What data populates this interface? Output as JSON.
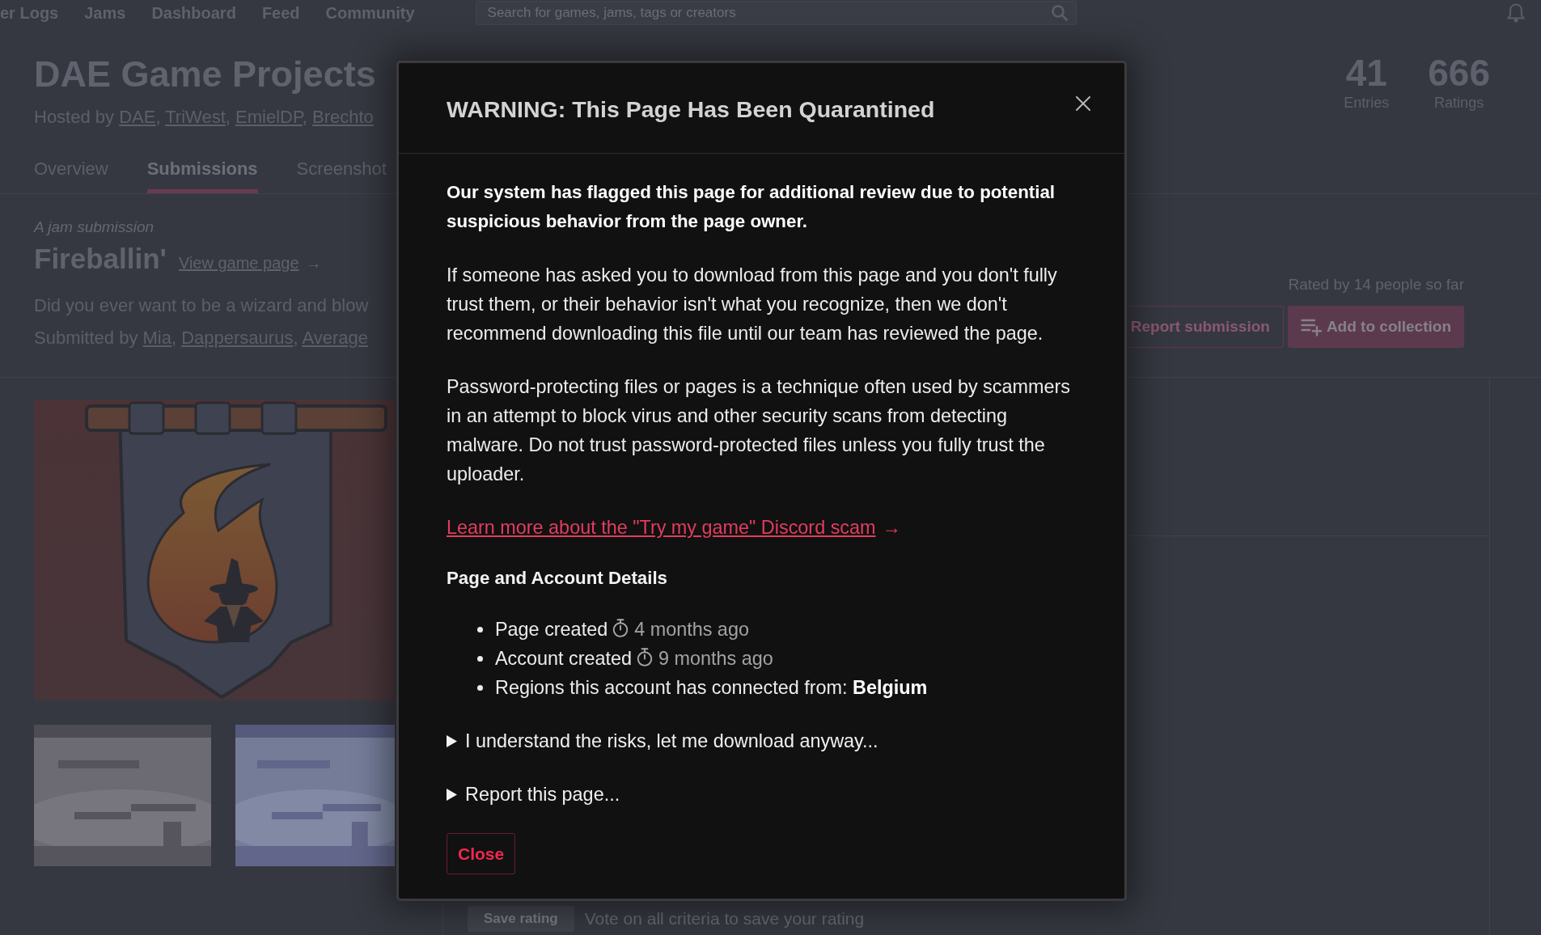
{
  "top_nav": {
    "links": [
      "er Logs",
      "Jams",
      "Dashboard",
      "Feed",
      "Community"
    ],
    "search": {
      "placeholder": "Search for games, jams, tags or creators"
    }
  },
  "jam": {
    "title": "DAE Game Projects",
    "hosted_by": {
      "label": "Hosted by",
      "separator": ", ",
      "hosts": [
        "DAE",
        "TriWest",
        "EmielDP",
        "Brechto"
      ]
    },
    "stats": [
      {
        "value": "41",
        "label": "Entries"
      },
      {
        "value": "666",
        "label": "Ratings"
      }
    ]
  },
  "tabs": [
    {
      "label": "Overview",
      "selected": false
    },
    {
      "label": "Submissions",
      "selected": true
    },
    {
      "label": "Screenshot",
      "selected": false
    }
  ],
  "submission": {
    "eyebrow": "A jam submission",
    "title": "Fireballin'",
    "game_link": {
      "text": "View game page",
      "arrow": "→"
    },
    "description": "Did you ever want to be a wizard and blow",
    "submitted_by": {
      "label": "Submitted by",
      "separator": ", ",
      "authors": [
        "Mia",
        "Dappersaurus",
        "Average"
      ]
    },
    "rated_by": "Rated by 14 people so far",
    "buttons": [
      {
        "kind": "outlined",
        "label": "Report submission"
      },
      {
        "kind": "primary",
        "label": "Add to collection"
      }
    ]
  },
  "media": {
    "screenshots": [
      {
        "kind": "cave"
      },
      {
        "kind": "sky"
      }
    ]
  },
  "rating": {
    "save_button": {
      "label": "Save rating",
      "disabled": true
    },
    "hint": "Vote on all criteria to save your rating"
  },
  "modal": {
    "title": "WARNING: This Page Has Been Quarantined",
    "paragraphs": [
      {
        "kind": "lead",
        "text": "Our system has flagged this page for additional review due to potential suspicious behavior from the page owner."
      },
      {
        "kind": "body",
        "text": "If someone has asked you to download from this page and you don't fully trust them, or their behavior isn't what you recognize, then we don't recommend downloading this file until our team has reviewed the page."
      },
      {
        "kind": "body",
        "text": "Password-protecting files or pages is a technique often used by scammers in an attempt to block virus and other security scans from detecting malware. Do not trust password-protected files unless you fully trust the uploader."
      }
    ],
    "link": {
      "text": "Learn more about the \"Try my game\" Discord scam",
      "arrow": "→"
    },
    "details_heading": "Page and Account Details",
    "details": [
      {
        "kind": "time",
        "label": "Page created",
        "time": "4 months ago"
      },
      {
        "kind": "time",
        "label": "Account created",
        "time": "9 months ago"
      },
      {
        "kind": "text",
        "text": "Regions this account has connected from: **Belgium**"
      }
    ],
    "disclosures": [
      {
        "label": "I understand the risks, let me download anyway...",
        "expanded": false
      },
      {
        "label": "Report this page...",
        "expanded": false
      }
    ],
    "close_button": "Close"
  }
}
